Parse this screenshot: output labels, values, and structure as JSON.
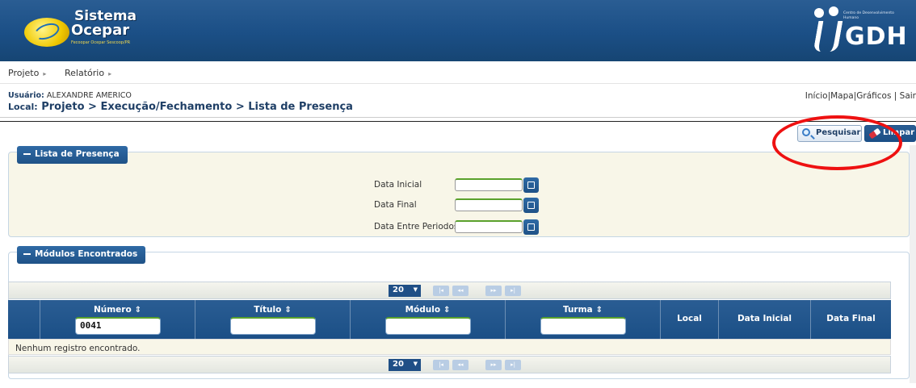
{
  "header": {
    "logo_line1": "Sistema",
    "logo_line2": "Ocepar",
    "logo_sub": "Fecoopar  Ocepar  Sescoop/PR",
    "right_small": "Centro de Desenvolvimento Humano",
    "right_logo": "GDH"
  },
  "menu": [
    {
      "label": "Projeto",
      "arrow": "▸"
    },
    {
      "label": "Relatório",
      "arrow": "▸"
    }
  ],
  "info": {
    "user_label": "Usuário:",
    "user_name": "ALEXANDRE AMERICO",
    "local_label": "Local:",
    "local_path": "Projeto > Execução/Fechamento > Lista de Presença",
    "links": [
      "Início",
      "|",
      "Mapa",
      "|",
      "Gráficos",
      " | ",
      "Sair"
    ]
  },
  "toolbar": {
    "search_label": "Pesquisar",
    "clear_label": "Limpar"
  },
  "filter_panel": {
    "title": "Lista de Presença",
    "fields": [
      {
        "label": "Data Inicial",
        "value": ""
      },
      {
        "label": "Data Final",
        "value": ""
      },
      {
        "label": "Data Entre Periodos",
        "value": ""
      }
    ]
  },
  "results_panel": {
    "title": "Módulos Encontrados",
    "page_size": "20",
    "pager_buttons": [
      "|◂",
      "◂◂",
      "▸▸",
      "▸|"
    ],
    "columns": [
      {
        "label": "Número",
        "sortable": true,
        "filter_value": "0041"
      },
      {
        "label": "Título",
        "sortable": true,
        "filter_value": ""
      },
      {
        "label": "Módulo",
        "sortable": true,
        "filter_value": ""
      },
      {
        "label": "Turma",
        "sortable": true,
        "filter_value": ""
      },
      {
        "label": "Local",
        "sortable": false
      },
      {
        "label": "Data Inicial",
        "sortable": false
      },
      {
        "label": "Data Final",
        "sortable": false
      }
    ],
    "sort_icon": "⇕",
    "empty_message": "Nenhum registro encontrado."
  },
  "colors": {
    "primary": "#1b4f86",
    "accent_green": "#5aa12c",
    "annotation_red": "#e11111"
  }
}
